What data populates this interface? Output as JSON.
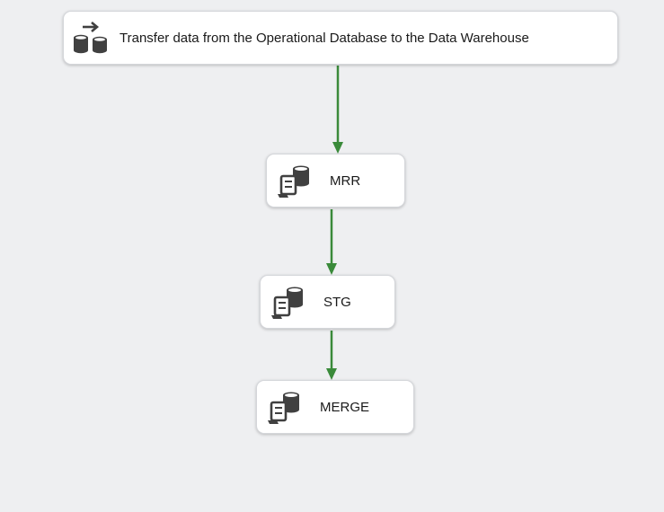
{
  "tasks": {
    "main": {
      "label": "Transfer data from the Operational Database to the Data Warehouse",
      "icon": "database-transfer-icon"
    },
    "mrr": {
      "label": "MRR",
      "icon": "execute-sql-icon"
    },
    "stg": {
      "label": "STG",
      "icon": "execute-sql-icon"
    },
    "merge": {
      "label": "MERGE",
      "icon": "execute-sql-icon"
    }
  },
  "colors": {
    "background": "#eeeff1",
    "connector": "#3a8a3a",
    "icon": "#404040"
  }
}
